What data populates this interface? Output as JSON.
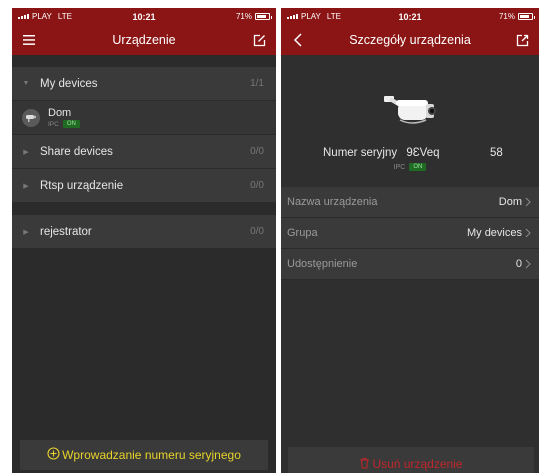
{
  "status_left": {
    "carrier": "PLAY",
    "network": "LTE",
    "time": "10:21",
    "battery": "71%"
  },
  "status_right": {
    "carrier": "PLAY",
    "network": "LTE",
    "time": "10:21",
    "battery": "71%"
  },
  "left_screen": {
    "title": "Urządzenie",
    "groups": [
      {
        "label": "My devices",
        "count": "1/1",
        "expanded": true
      },
      {
        "label": "Share devices",
        "count": "0/0"
      },
      {
        "label": "Rtsp urządzenie",
        "count": "0/0"
      },
      {
        "label": "rejestrator",
        "count": "0/0"
      }
    ],
    "device": {
      "name": "Dom",
      "type": "IPC",
      "state": "ON"
    },
    "bottom_button": "Wprowadzanie numeru seryjnego",
    "icons": {
      "menu": "menu-icon",
      "edit": "edit-icon",
      "add": "plus-circle-icon",
      "camera": "camera-icon"
    }
  },
  "right_screen": {
    "title": "Szczegóły urządzenia",
    "serial_label": "Numer seryjny",
    "serial_left": "9ƐVeq",
    "serial_right": "58",
    "device_type": "IPC",
    "device_state": "ON",
    "rows": [
      {
        "label": "Nazwa urządzenia",
        "value": "Dom"
      },
      {
        "label": "Grupa",
        "value": "My devices"
      },
      {
        "label": "Udostępnienie",
        "value": "0"
      }
    ],
    "delete_button": "Usuń urządzenie",
    "icons": {
      "back": "chevron-left-icon",
      "share": "share-icon",
      "camera": "camera-icon",
      "trash": "trash-icon"
    }
  },
  "colors": {
    "header": "#8b1414",
    "background": "#2b2b2b",
    "row": "#3a3a3a",
    "accent_yellow": "#e8d32a",
    "delete_red": "#c0262b",
    "on_green": "#1f6b24"
  }
}
